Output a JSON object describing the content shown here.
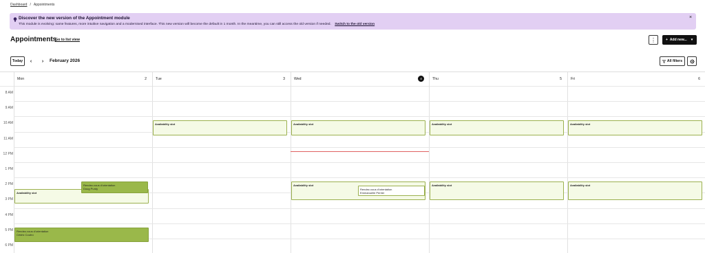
{
  "breadcrumb": {
    "home": "Dashboard",
    "separator": "/",
    "current": "Appointments"
  },
  "banner": {
    "icon": "lightbulb-icon",
    "title": "Discover the new version of the Appointment module",
    "text": "This module is evolving: same features, more intuitive navigation and a modernised interface. This new version will become the default in 1 month. In the meantime, you can still access the old version if needed.",
    "link": "Switch to the old version",
    "close": "×",
    "bg_color": "#e2cff3"
  },
  "header": {
    "title": "Appointments",
    "list_view_link": "Go to list view",
    "more_icon": "⋮",
    "add_new_label": "Add new...",
    "add_icon": "+",
    "caret_icon": "▾"
  },
  "toolbar": {
    "today_label": "Today",
    "prev_icon": "‹",
    "next_icon": "›",
    "month": "February 2026",
    "filters_label": "All filters",
    "filter_icon": "funnel-icon",
    "settings_icon": "gear-icon"
  },
  "calendar": {
    "days": [
      {
        "name": "Mon",
        "num": "2",
        "today": false
      },
      {
        "name": "Tue",
        "num": "3",
        "today": false
      },
      {
        "name": "Wed",
        "num": "4",
        "today": true
      },
      {
        "name": "Thu",
        "num": "5",
        "today": false
      },
      {
        "name": "Fri",
        "num": "6",
        "today": false
      }
    ],
    "hours": [
      "8 AM",
      "9 AM",
      "10 AM",
      "11 AM",
      "12 PM",
      "1 PM",
      "2 PM",
      "3 PM",
      "4 PM",
      "5 PM",
      "6 PM"
    ],
    "events": [
      {
        "day": 1,
        "start": "10:00",
        "end": "11:00",
        "kind": "slot",
        "title": "Availability slot"
      },
      {
        "day": 2,
        "start": "10:00",
        "end": "11:00",
        "kind": "slot",
        "title": "Availability slot"
      },
      {
        "day": 3,
        "start": "10:00",
        "end": "11:00",
        "kind": "slot",
        "title": "Availability slot"
      },
      {
        "day": 4,
        "start": "10:00",
        "end": "11:00",
        "kind": "slot",
        "title": "Availability slot"
      },
      {
        "day": 2,
        "start": "14:00",
        "end": "15:15",
        "kind": "slot",
        "title": "Availability slot"
      },
      {
        "day": 3,
        "start": "14:00",
        "end": "15:15",
        "kind": "slot",
        "title": "Availability slot"
      },
      {
        "day": 4,
        "start": "14:00",
        "end": "15:15",
        "kind": "slot",
        "title": "Availability slot"
      },
      {
        "day": 0,
        "start": "14:30",
        "end": "15:30",
        "kind": "slot",
        "title": "Availability slot"
      },
      {
        "day": 0,
        "start": "14:00",
        "end": "14:45",
        "kind": "appt",
        "title": "Rendez-vous d'orientation",
        "sub": "Doug Purdy"
      },
      {
        "day": 2,
        "start": "14:15",
        "end": "15:00",
        "kind": "appt-light",
        "title": "Rendez-vous d'orientation",
        "sub": "Emmanuelle Perrier"
      },
      {
        "day": 0,
        "start": "17:00",
        "end": "18:00",
        "kind": "appt",
        "title": "Rendez-vous d'orientation",
        "sub": "Cédric Coutro"
      }
    ],
    "now_time": "12:20"
  }
}
